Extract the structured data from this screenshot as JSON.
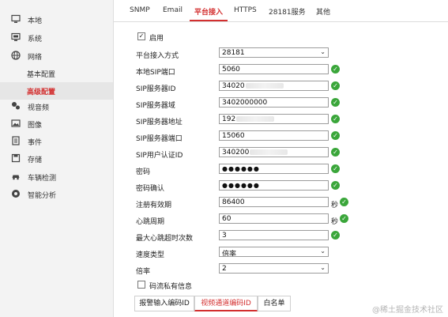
{
  "sidebar": {
    "items": [
      {
        "label": "本地",
        "icon": "monitor-icon"
      },
      {
        "label": "系统",
        "icon": "system-icon"
      },
      {
        "label": "网络",
        "icon": "globe-icon"
      },
      {
        "label": "基本配置",
        "icon": ""
      },
      {
        "label": "高级配置",
        "icon": ""
      },
      {
        "label": "视音频",
        "icon": "audio-video-icon"
      },
      {
        "label": "图像",
        "icon": "image-icon"
      },
      {
        "label": "事件",
        "icon": "event-icon"
      },
      {
        "label": "存储",
        "icon": "storage-icon"
      },
      {
        "label": "车辆检测",
        "icon": "vehicle-icon"
      },
      {
        "label": "智能分析",
        "icon": "smart-analysis-icon"
      }
    ],
    "active": "高级配置"
  },
  "tabs": [
    "SNMP",
    "Email",
    "平台接入",
    "HTTPS",
    "28181服务",
    "其他"
  ],
  "active_tab": "平台接入",
  "enable": {
    "label": "启用",
    "checked": true
  },
  "form": {
    "access_mode": {
      "label": "平台接入方式",
      "value": "28181"
    },
    "local_sip_port": {
      "label": "本地SIP端口",
      "value": "5060"
    },
    "sip_server_id": {
      "label": "SIP服务器ID",
      "value": "34020"
    },
    "sip_server_domain": {
      "label": "SIP服务器域",
      "value": "3402000000"
    },
    "sip_server_address": {
      "label": "SIP服务器地址",
      "value": "192"
    },
    "sip_server_port": {
      "label": "SIP服务器端口",
      "value": "15060"
    },
    "sip_user_auth_id": {
      "label": "SIP用户认证ID",
      "value": "340200"
    },
    "password": {
      "label": "密码",
      "value": "●●●●●●"
    },
    "password_confirm": {
      "label": "密码确认",
      "value": "●●●●●●"
    },
    "register_validity": {
      "label": "注册有效期",
      "value": "86400",
      "unit": "秒"
    },
    "heartbeat_period": {
      "label": "心跳周期",
      "value": "60",
      "unit": "秒"
    },
    "max_heartbeat_timeout": {
      "label": "最大心跳超时次数",
      "value": "3"
    },
    "speed_type": {
      "label": "速度类型",
      "value": "倍率"
    },
    "rate": {
      "label": "倍率",
      "value": "2"
    }
  },
  "stream_private": {
    "label": "码流私有信息",
    "checked": false
  },
  "subtabs": [
    "报警输入编码ID",
    "视频通道编码ID",
    "白名单"
  ],
  "active_subtab": "视频通道编码ID",
  "watermark": "@稀土掘金技术社区",
  "colors": {
    "accent": "#d32f2f",
    "ok": "#3aa63a"
  }
}
